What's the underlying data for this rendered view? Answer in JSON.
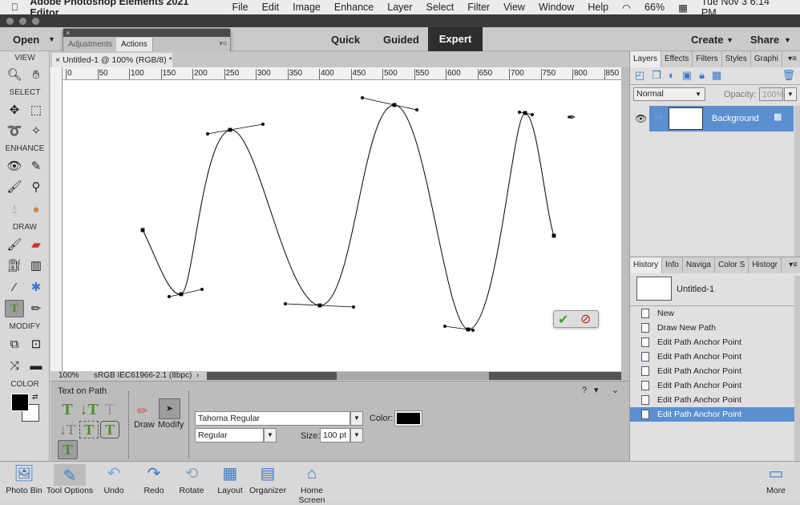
{
  "menubar": {
    "app": "Adobe Photoshop Elements 2021 Editor",
    "items": [
      "File",
      "Edit",
      "Image",
      "Enhance",
      "Layer",
      "Select",
      "Filter",
      "View",
      "Window",
      "Help"
    ],
    "battery": "66%",
    "clock": "Tue Nov 3  6:14 PM"
  },
  "topbar": {
    "open": "Open",
    "modes": [
      "Quick",
      "Guided",
      "Expert"
    ],
    "active_mode": "Expert",
    "create": "Create",
    "share": "Share"
  },
  "float_panel": {
    "tabs": [
      "Adjustments",
      "Actions"
    ],
    "active": "Actions"
  },
  "toolbar": {
    "sections": [
      "VIEW",
      "SELECT",
      "ENHANCE",
      "DRAW",
      "MODIFY",
      "COLOR"
    ]
  },
  "document": {
    "tab": "Untitled-1 @ 100% (RGB/8) *",
    "zoom": "100%",
    "profile": "sRGB IEC61966-2.1 (8bpc)",
    "hruler": [
      "0",
      "50",
      "100",
      "150",
      "200",
      "250",
      "300",
      "350",
      "400",
      "450",
      "500",
      "550",
      "600",
      "650",
      "700",
      "750",
      "800",
      "850"
    ]
  },
  "tool_options": {
    "title": "Text on Path",
    "draw": "Draw",
    "modify": "Modify",
    "font": "Tahoma Regular",
    "style": "Regular",
    "size_label": "Size:",
    "size": "100 pt",
    "color_label": "Color:",
    "color": "#000000"
  },
  "bottom": {
    "items": [
      "Photo Bin",
      "Tool Options",
      "Undo",
      "Redo",
      "Rotate",
      "Layout",
      "Organizer",
      "Home Screen"
    ],
    "more": "More"
  },
  "layers": {
    "tabs": [
      "Layers",
      "Effects",
      "Filters",
      "Styles",
      "Graphi"
    ],
    "blend": "Normal",
    "opacity_label": "Opacity:",
    "opacity": "100%",
    "layer": "Background"
  },
  "history": {
    "tabs": [
      "History",
      "Info",
      "Naviga",
      "Color S",
      "Histogr"
    ],
    "snapshot": "Untitled-1",
    "items": [
      "New",
      "Draw New Path",
      "Edit Path Anchor Point",
      "Edit Path Anchor Point",
      "Edit Path Anchor Point",
      "Edit Path Anchor Point",
      "Edit Path Anchor Point",
      "Edit Path Anchor Point"
    ],
    "selected_index": 7
  },
  "colors": {
    "accent": "#5b8fd0",
    "text_tool": "#4f8a2e"
  }
}
